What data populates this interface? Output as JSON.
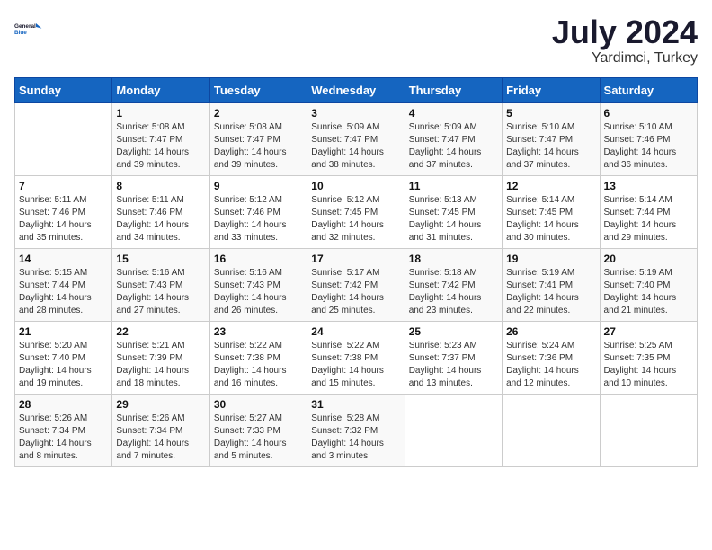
{
  "logo": {
    "text_general": "General",
    "text_blue": "Blue"
  },
  "title": "July 2024",
  "subtitle": "Yardimci, Turkey",
  "days_header": [
    "Sunday",
    "Monday",
    "Tuesday",
    "Wednesday",
    "Thursday",
    "Friday",
    "Saturday"
  ],
  "weeks": [
    [
      {
        "day": "",
        "info": ""
      },
      {
        "day": "1",
        "info": "Sunrise: 5:08 AM\nSunset: 7:47 PM\nDaylight: 14 hours\nand 39 minutes."
      },
      {
        "day": "2",
        "info": "Sunrise: 5:08 AM\nSunset: 7:47 PM\nDaylight: 14 hours\nand 39 minutes."
      },
      {
        "day": "3",
        "info": "Sunrise: 5:09 AM\nSunset: 7:47 PM\nDaylight: 14 hours\nand 38 minutes."
      },
      {
        "day": "4",
        "info": "Sunrise: 5:09 AM\nSunset: 7:47 PM\nDaylight: 14 hours\nand 37 minutes."
      },
      {
        "day": "5",
        "info": "Sunrise: 5:10 AM\nSunset: 7:47 PM\nDaylight: 14 hours\nand 37 minutes."
      },
      {
        "day": "6",
        "info": "Sunrise: 5:10 AM\nSunset: 7:46 PM\nDaylight: 14 hours\nand 36 minutes."
      }
    ],
    [
      {
        "day": "7",
        "info": "Sunrise: 5:11 AM\nSunset: 7:46 PM\nDaylight: 14 hours\nand 35 minutes."
      },
      {
        "day": "8",
        "info": "Sunrise: 5:11 AM\nSunset: 7:46 PM\nDaylight: 14 hours\nand 34 minutes."
      },
      {
        "day": "9",
        "info": "Sunrise: 5:12 AM\nSunset: 7:46 PM\nDaylight: 14 hours\nand 33 minutes."
      },
      {
        "day": "10",
        "info": "Sunrise: 5:12 AM\nSunset: 7:45 PM\nDaylight: 14 hours\nand 32 minutes."
      },
      {
        "day": "11",
        "info": "Sunrise: 5:13 AM\nSunset: 7:45 PM\nDaylight: 14 hours\nand 31 minutes."
      },
      {
        "day": "12",
        "info": "Sunrise: 5:14 AM\nSunset: 7:45 PM\nDaylight: 14 hours\nand 30 minutes."
      },
      {
        "day": "13",
        "info": "Sunrise: 5:14 AM\nSunset: 7:44 PM\nDaylight: 14 hours\nand 29 minutes."
      }
    ],
    [
      {
        "day": "14",
        "info": "Sunrise: 5:15 AM\nSunset: 7:44 PM\nDaylight: 14 hours\nand 28 minutes."
      },
      {
        "day": "15",
        "info": "Sunrise: 5:16 AM\nSunset: 7:43 PM\nDaylight: 14 hours\nand 27 minutes."
      },
      {
        "day": "16",
        "info": "Sunrise: 5:16 AM\nSunset: 7:43 PM\nDaylight: 14 hours\nand 26 minutes."
      },
      {
        "day": "17",
        "info": "Sunrise: 5:17 AM\nSunset: 7:42 PM\nDaylight: 14 hours\nand 25 minutes."
      },
      {
        "day": "18",
        "info": "Sunrise: 5:18 AM\nSunset: 7:42 PM\nDaylight: 14 hours\nand 23 minutes."
      },
      {
        "day": "19",
        "info": "Sunrise: 5:19 AM\nSunset: 7:41 PM\nDaylight: 14 hours\nand 22 minutes."
      },
      {
        "day": "20",
        "info": "Sunrise: 5:19 AM\nSunset: 7:40 PM\nDaylight: 14 hours\nand 21 minutes."
      }
    ],
    [
      {
        "day": "21",
        "info": "Sunrise: 5:20 AM\nSunset: 7:40 PM\nDaylight: 14 hours\nand 19 minutes."
      },
      {
        "day": "22",
        "info": "Sunrise: 5:21 AM\nSunset: 7:39 PM\nDaylight: 14 hours\nand 18 minutes."
      },
      {
        "day": "23",
        "info": "Sunrise: 5:22 AM\nSunset: 7:38 PM\nDaylight: 14 hours\nand 16 minutes."
      },
      {
        "day": "24",
        "info": "Sunrise: 5:22 AM\nSunset: 7:38 PM\nDaylight: 14 hours\nand 15 minutes."
      },
      {
        "day": "25",
        "info": "Sunrise: 5:23 AM\nSunset: 7:37 PM\nDaylight: 14 hours\nand 13 minutes."
      },
      {
        "day": "26",
        "info": "Sunrise: 5:24 AM\nSunset: 7:36 PM\nDaylight: 14 hours\nand 12 minutes."
      },
      {
        "day": "27",
        "info": "Sunrise: 5:25 AM\nSunset: 7:35 PM\nDaylight: 14 hours\nand 10 minutes."
      }
    ],
    [
      {
        "day": "28",
        "info": "Sunrise: 5:26 AM\nSunset: 7:34 PM\nDaylight: 14 hours\nand 8 minutes."
      },
      {
        "day": "29",
        "info": "Sunrise: 5:26 AM\nSunset: 7:34 PM\nDaylight: 14 hours\nand 7 minutes."
      },
      {
        "day": "30",
        "info": "Sunrise: 5:27 AM\nSunset: 7:33 PM\nDaylight: 14 hours\nand 5 minutes."
      },
      {
        "day": "31",
        "info": "Sunrise: 5:28 AM\nSunset: 7:32 PM\nDaylight: 14 hours\nand 3 minutes."
      },
      {
        "day": "",
        "info": ""
      },
      {
        "day": "",
        "info": ""
      },
      {
        "day": "",
        "info": ""
      }
    ]
  ]
}
